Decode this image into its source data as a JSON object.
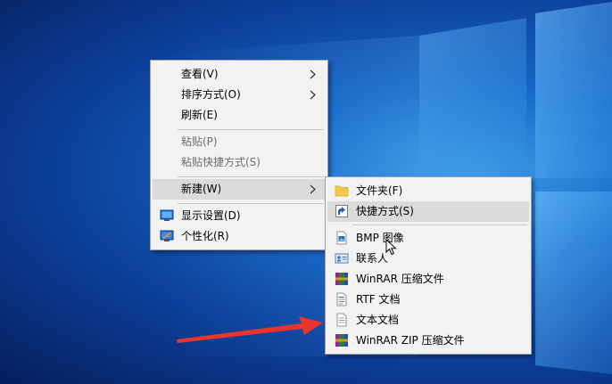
{
  "desktop": {
    "accent_color": "#0c3f99",
    "logo": "windows-10-logo"
  },
  "context_menu": {
    "items": [
      {
        "label": "查看(V)",
        "has_submenu": true,
        "enabled": true
      },
      {
        "label": "排序方式(O)",
        "has_submenu": true,
        "enabled": true
      },
      {
        "label": "刷新(E)",
        "has_submenu": false,
        "enabled": true
      },
      {
        "label": "粘贴(P)",
        "has_submenu": false,
        "enabled": false
      },
      {
        "label": "粘贴快捷方式(S)",
        "has_submenu": false,
        "enabled": false
      },
      {
        "label": "新建(W)",
        "has_submenu": true,
        "enabled": true,
        "highlighted": true
      },
      {
        "label": "显示设置(D)",
        "icon": "display-settings-icon",
        "enabled": true
      },
      {
        "label": "个性化(R)",
        "icon": "personalize-icon",
        "enabled": true
      }
    ]
  },
  "new_submenu": {
    "items": [
      {
        "label": "文件夹(F)",
        "icon": "folder-icon"
      },
      {
        "label": "快捷方式(S)",
        "icon": "shortcut-icon",
        "highlighted": true
      },
      {
        "label": "BMP 图像",
        "icon": "bmp-image-icon"
      },
      {
        "label": "联系人",
        "icon": "contact-icon"
      },
      {
        "label": "WinRAR 压缩文件",
        "icon": "winrar-icon"
      },
      {
        "label": "RTF 文档",
        "icon": "rtf-document-icon"
      },
      {
        "label": "文本文档",
        "icon": "text-document-icon"
      },
      {
        "label": "WinRAR ZIP 压缩文件",
        "icon": "winrar-zip-icon"
      }
    ]
  },
  "annotation": {
    "color": "#e8362c",
    "points_to": "文本文档"
  }
}
